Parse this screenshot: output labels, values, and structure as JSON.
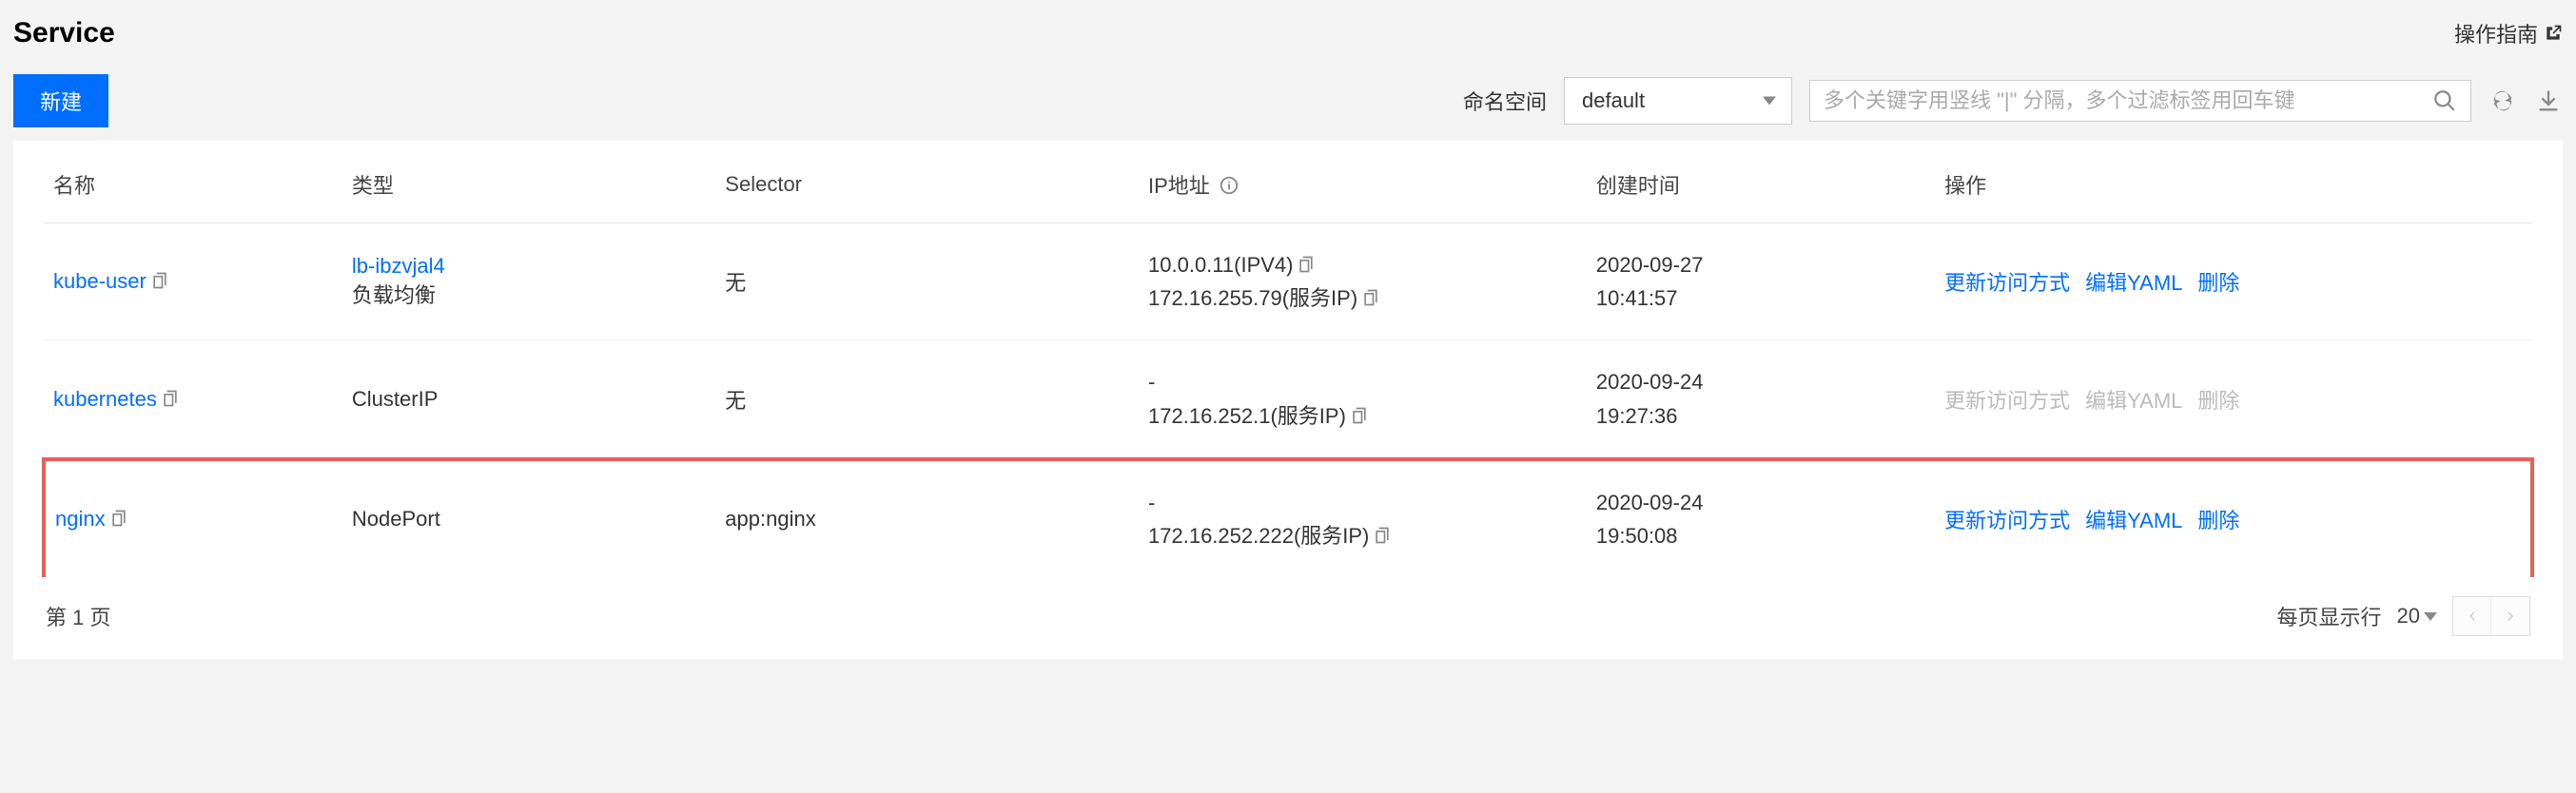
{
  "page_title": "Service",
  "help_link_label": "操作指南",
  "toolbar": {
    "create_label": "新建",
    "namespace_label": "命名空间",
    "namespace_value": "default",
    "search_placeholder": "多个关键字用竖线 \"|\" 分隔，多个过滤标签用回车键"
  },
  "table": {
    "headers": {
      "name": "名称",
      "type": "类型",
      "selector": "Selector",
      "ip": "IP地址",
      "created": "创建时间",
      "actions": "操作"
    },
    "rows": [
      {
        "name": "kube-user",
        "type_link": "lb-ibzvjal4",
        "type_sub": "负载均衡",
        "selector": "无",
        "ip_lines": [
          "10.0.0.11(IPV4)",
          "172.16.255.79(服务IP)"
        ],
        "created_date": "2020-09-27",
        "created_time": "10:41:57",
        "actions_disabled": false,
        "highlighted": false
      },
      {
        "name": "kubernetes",
        "type_link": "",
        "type_sub": "ClusterIP",
        "selector": "无",
        "ip_lines": [
          "-",
          "172.16.252.1(服务IP)"
        ],
        "created_date": "2020-09-24",
        "created_time": "19:27:36",
        "actions_disabled": true,
        "highlighted": false
      },
      {
        "name": "nginx",
        "type_link": "",
        "type_sub": "NodePort",
        "selector": "app:nginx",
        "ip_lines": [
          "-",
          "172.16.252.222(服务IP)"
        ],
        "created_date": "2020-09-24",
        "created_time": "19:50:08",
        "actions_disabled": false,
        "highlighted": true
      }
    ],
    "action_labels": {
      "update_access": "更新访问方式",
      "edit_yaml": "编辑YAML",
      "delete": "删除"
    }
  },
  "footer": {
    "page_label": "第 1 页",
    "page_size_label": "每页显示行",
    "page_size_value": "20"
  }
}
